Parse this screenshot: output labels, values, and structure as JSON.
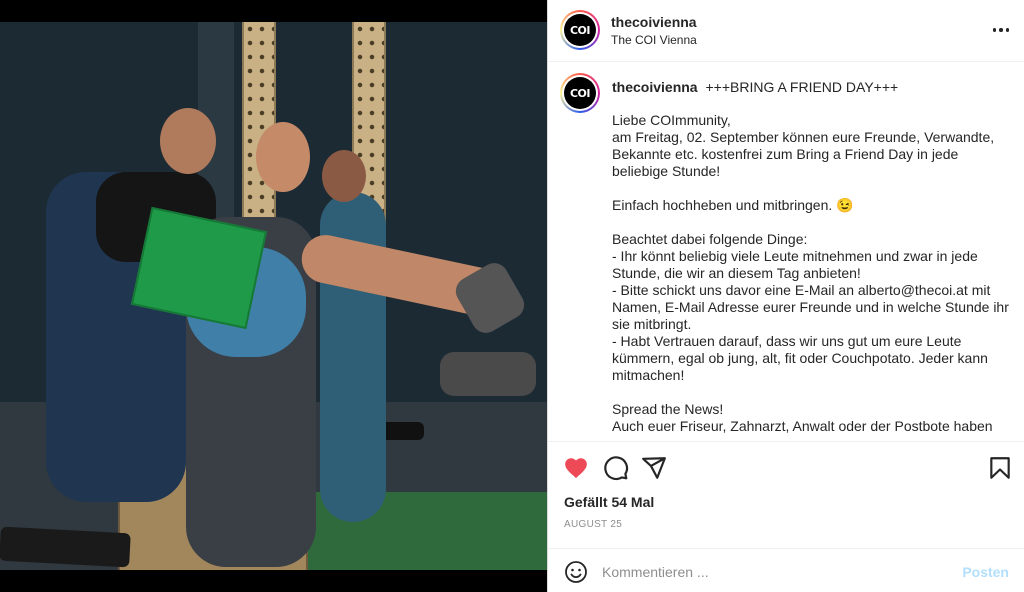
{
  "post": {
    "image_alt": "",
    "header": {
      "username": "thecoivienna",
      "location": "The COI Vienna",
      "avatar_text": "COI"
    },
    "caption": {
      "username": "thecoivienna",
      "title": "+++BRING A FRIEND DAY+++",
      "lines": [
        "Liebe COImmunity,",
        "am Freitag, 02. September können eure Freunde, Verwandte, Bekannte etc. kostenfrei zum Bring a Friend Day in jede beliebige Stunde!",
        "",
        "Einfach hochheben und mitbringen. 😉",
        "",
        "Beachtet dabei folgende Dinge:",
        "- Ihr könnt beliebig viele Leute mitnehmen und zwar in jede Stunde, die wir an diesem Tag anbieten!",
        "- Bitte schickt uns davor eine E-Mail an alberto@thecoi.at mit Namen, E-Mail Adresse eurer Freunde und in welche Stunde ihr sie mitbringt.",
        "- Habt Vertrauen darauf, dass wir uns gut um eure Leute kümmern, egal ob jung, alt, fit oder Couchpotato. Jeder kann mitmachen!",
        "",
        "Spread the News!",
        "Auch euer Friseur, Zahnarzt, Anwalt oder der Postbote haben"
      ]
    },
    "likes_text": "Gefällt 54 Mal",
    "date_text": "AUGUST 25",
    "comment": {
      "placeholder": "Kommentieren ...",
      "post_label": "Posten"
    }
  },
  "icons": {
    "like": "heart-icon",
    "comment": "comment-icon",
    "share": "share-icon",
    "save": "bookmark-icon",
    "emoji": "emoji-icon",
    "more": "more-icon"
  },
  "colors": {
    "like_active": "#ed4956",
    "post_disabled": "#b2dffc",
    "muted_text": "#8e8e8e",
    "border": "#dbdbdb"
  }
}
